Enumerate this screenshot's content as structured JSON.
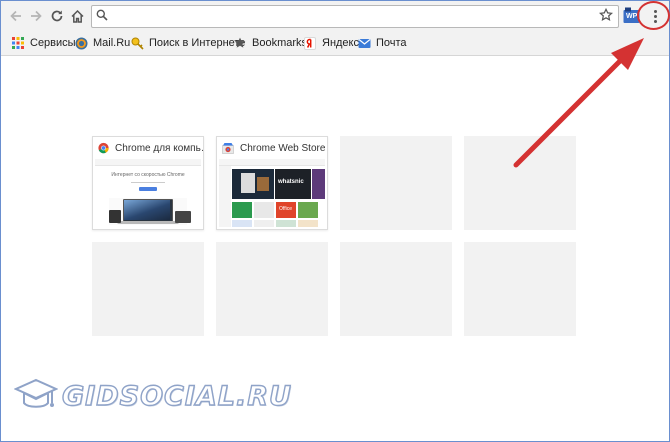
{
  "toolbar": {
    "address_value": "",
    "extension_label": "WP",
    "colors": {
      "accent_circle": "#d43232",
      "arrow": "#d43232"
    }
  },
  "bookmarks": [
    {
      "label": "Сервисы",
      "icon": "apps-grid-icon"
    },
    {
      "label": "Mail.Ru",
      "icon": "mailru-icon"
    },
    {
      "label": "Поиск в Интернете",
      "icon": "search-key-icon"
    },
    {
      "label": "Bookmarks",
      "icon": "star-icon"
    },
    {
      "label": "Яндекс",
      "icon": "yandex-icon"
    },
    {
      "label": "Почта",
      "icon": "mail-icon"
    }
  ],
  "tiles": [
    {
      "title": "Chrome для компь…",
      "thumb_heading": "Интернет со скоростью Chrome"
    },
    {
      "title": "Chrome Web Store",
      "thumb_badge": "whatsnic",
      "thumb_office": "Office"
    }
  ],
  "watermark": {
    "text": "GIDSOCIAL.RU"
  }
}
